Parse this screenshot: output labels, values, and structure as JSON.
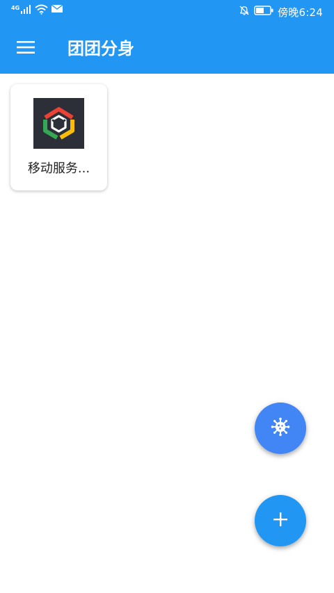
{
  "status_bar": {
    "network_type": "4G",
    "time": "傍晚6:24"
  },
  "toolbar": {
    "menu_icon": "hamburger-menu-icon",
    "title": "团团分身"
  },
  "apps": [
    {
      "name": "移动服务...",
      "icon": "hexagon-cube-logo"
    }
  ],
  "fabs": {
    "virus_icon": "virus-icon",
    "add_icon": "plus-icon"
  },
  "colors": {
    "primary": "#2196f3",
    "fab_virus": "#4285f4",
    "fab_add": "#2196f3",
    "card_background": "#ffffff"
  }
}
